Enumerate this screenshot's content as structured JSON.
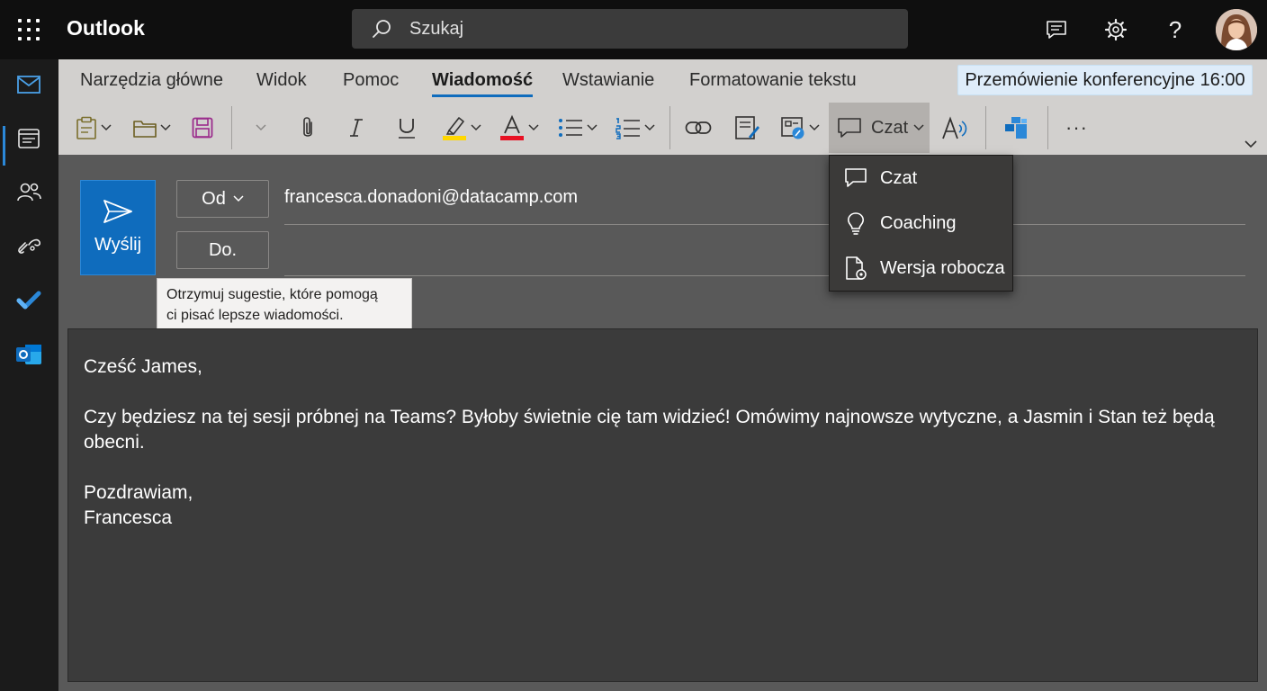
{
  "app": {
    "title": "Outlook"
  },
  "search": {
    "placeholder": "Szukaj"
  },
  "ribbon": {
    "tabs": [
      {
        "label": "Narzędzia główne"
      },
      {
        "label": "Widok"
      },
      {
        "label": "Pomoc"
      },
      {
        "label": "Wiadomość",
        "active": true
      },
      {
        "label": "Wstawianie"
      },
      {
        "label": "Formatowanie tekstu"
      }
    ],
    "reminder": "Przemówienie konferencyjne 16:00",
    "czat_label": "Czat",
    "more_label": "···",
    "highlight_color": "#ffd700",
    "font_color": "#e81123"
  },
  "compose": {
    "send_label": "Wyślij",
    "from_label": "Od",
    "from_value": "francesca.donadoni@datacamp.com",
    "to_label": "Do."
  },
  "tooltip": {
    "line1": "Otrzymuj sugestie, które pomogą",
    "line2": "ci pisać lepsze wiadomości."
  },
  "dropdown": {
    "items": [
      {
        "label": "Czat",
        "icon": "chat-icon"
      },
      {
        "label": "Coaching",
        "icon": "lightbulb-icon"
      },
      {
        "label": "Wersja robocza",
        "icon": "draft-document-icon"
      }
    ]
  },
  "message": {
    "greeting": "Cześć James,",
    "body": "Czy będziesz na tej sesji próbnej na Teams? Byłoby świetnie cię tam widzieć! Omówimy najnowsze wytyczne, a Jasmin i Stan też będą obecni.",
    "closing": "Pozdrawiam,",
    "signature": "Francesca"
  },
  "colors": {
    "accent": "#0f6cbd",
    "topbar": "#0f0f0f",
    "ribbon": "#d2d0ce"
  }
}
